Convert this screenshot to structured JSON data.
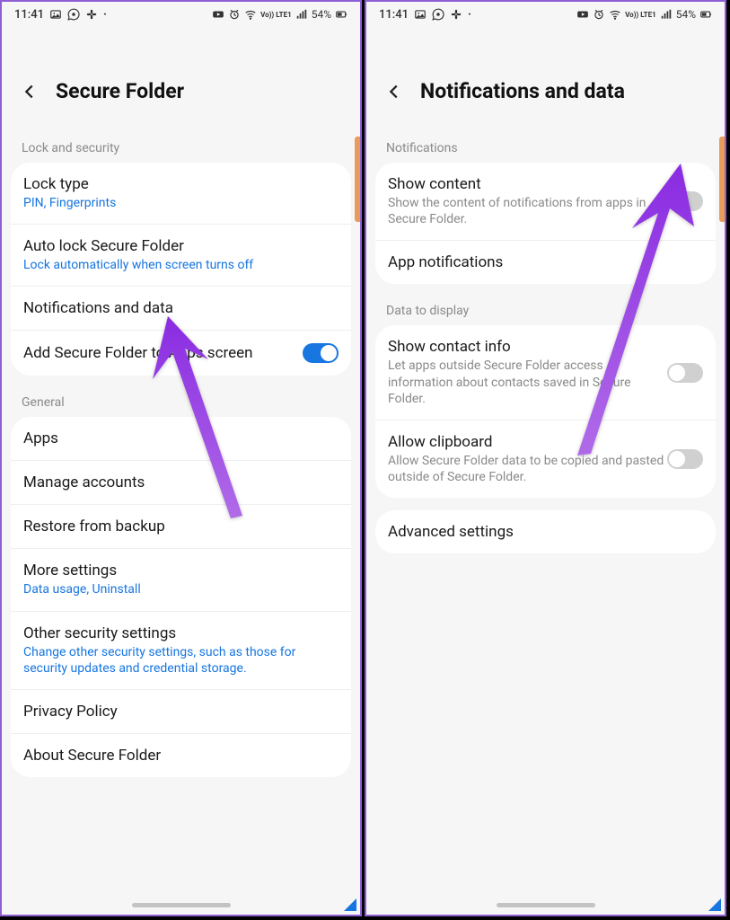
{
  "status": {
    "time": "11:41",
    "battery": "54%",
    "network": "Vo)) LTE1",
    "left_icons": [
      "picture",
      "whatsapp",
      "slack",
      "dot"
    ],
    "right_icons": [
      "youtube",
      "alarm",
      "wifi",
      "volte",
      "signal",
      "battery"
    ]
  },
  "left": {
    "title": "Secure Folder",
    "section1": "Lock and security",
    "lock_type": {
      "title": "Lock type",
      "sub": "PIN, Fingerprints"
    },
    "auto_lock": {
      "title": "Auto lock Secure Folder",
      "sub": "Lock automatically when screen turns off"
    },
    "notif_data": {
      "title": "Notifications and data"
    },
    "add_apps": {
      "title": "Add Secure Folder to Apps screen"
    },
    "section2": "General",
    "apps": {
      "title": "Apps"
    },
    "manage": {
      "title": "Manage accounts"
    },
    "restore": {
      "title": "Restore from backup"
    },
    "more": {
      "title": "More settings",
      "sub": "Data usage, Uninstall"
    },
    "other": {
      "title": "Other security settings",
      "sub": "Change other security settings, such as those for security updates and credential storage."
    },
    "privacy": {
      "title": "Privacy Policy"
    },
    "about": {
      "title": "About Secure Folder"
    }
  },
  "right": {
    "title": "Notifications and data",
    "section1": "Notifications",
    "show_content": {
      "title": "Show content",
      "sub": "Show the content of notifications from apps in Secure Folder."
    },
    "app_notif": {
      "title": "App notifications"
    },
    "section2": "Data to display",
    "contact": {
      "title": "Show contact info",
      "sub": "Let apps outside Secure Folder access information about contacts saved in Secure Folder."
    },
    "clipboard": {
      "title": "Allow clipboard",
      "sub": "Allow Secure Folder data to be copied and pasted outside of Secure Folder."
    },
    "advanced": {
      "title": "Advanced settings"
    }
  }
}
